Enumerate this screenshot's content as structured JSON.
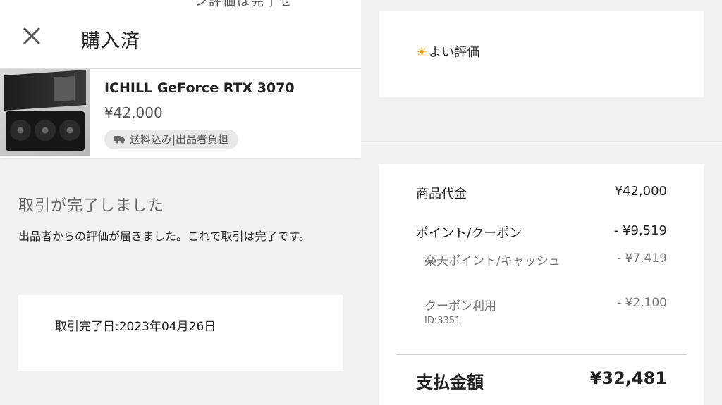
{
  "header": {
    "partial_top_text": "ン評価は完了せ",
    "title": "購入済"
  },
  "product": {
    "name": "ICHILL GeForce RTX 3070",
    "price": "¥42,000",
    "shipping": "送料込み|出品者負担"
  },
  "status": {
    "title": "取引が完了しました",
    "message": "出品者からの評価が届きました。これで取引は完了です。",
    "completion_date": "取引完了日:2023年04月26日"
  },
  "rating": {
    "icon": "☀",
    "label": "よい評価"
  },
  "bill": {
    "item_price_label": "商品代金",
    "item_price_value": "¥42,000",
    "points_coupon_label": "ポイント/クーポン",
    "points_coupon_value": "- ¥9,519",
    "rakuten_points_label": "楽天ポイント/キャッシュ",
    "rakuten_points_value": "- ¥7,419",
    "coupon_label": "クーポン利用",
    "coupon_value": "- ¥2,100",
    "coupon_id": "ID:3351",
    "total_label": "支払金額",
    "total_value": "¥32,481"
  },
  "colors": {
    "background": "#f2f2f2",
    "card": "#ffffff",
    "sun": "#f0a800",
    "text": "#222222",
    "muted": "#777777"
  }
}
